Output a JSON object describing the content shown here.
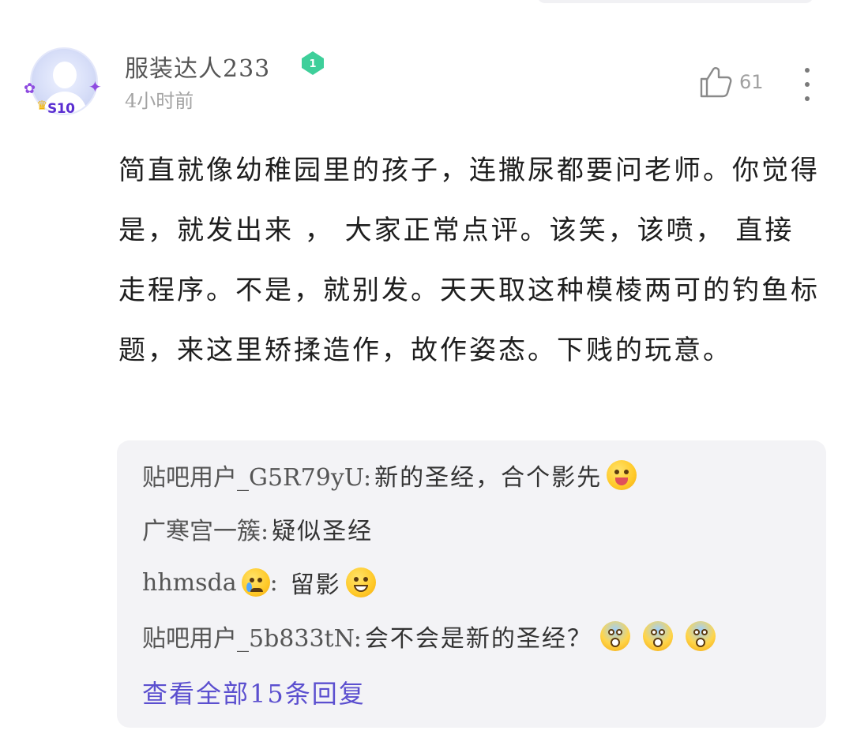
{
  "post": {
    "username": "服装达人233",
    "level": "1",
    "time": "4小时前",
    "like_count": "61",
    "avatar_badge": "S10",
    "content": "简直就像幼稚园里的孩子，连撒尿都要问老师。你觉得是，就发出来 ， 大家正常点评。该笑，该喷， 直接走程序。不是，就别发。天天取这种模棱两可的钓鱼标题，来这里矫揉造作，故作姿态。下贱的玩意。"
  },
  "replies": [
    {
      "author": "贴吧用户_G5R79yU:",
      "text": "新的圣经，合个影先",
      "emojis": [
        "tongue-face-icon"
      ]
    },
    {
      "author": "广寒宫一簇:",
      "text": "疑似圣经",
      "emojis": []
    },
    {
      "author": "hhmsda",
      "author_emoji": "crying-face-icon",
      "author_suffix": ":",
      "text": "留影",
      "emojis": [
        "grinning-face-icon"
      ]
    },
    {
      "author": "贴吧用户_5b833tN:",
      "text": "会不会是新的圣经？",
      "emojis": [
        "scared-face-icon",
        "scared-face-icon",
        "scared-face-icon"
      ]
    }
  ],
  "view_all_label": "查看全部15条回复",
  "colors": {
    "accent": "#5b4fcf",
    "badge": "#3ecf9a",
    "reply_bg": "#f3f3f6"
  }
}
